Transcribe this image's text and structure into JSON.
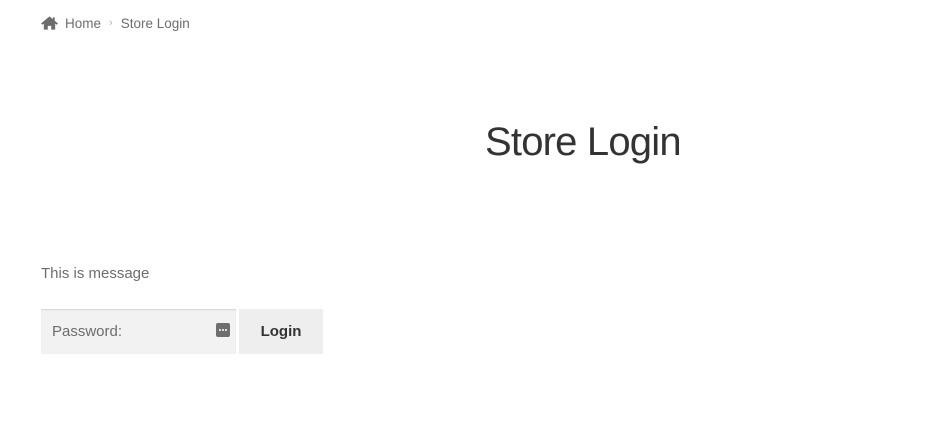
{
  "breadcrumb": {
    "home_label": "Home",
    "current_label": "Store Login"
  },
  "page": {
    "title": "Store Login",
    "message": "This is message"
  },
  "form": {
    "password_placeholder": "Password:",
    "password_value": "",
    "login_label": "Login"
  },
  "colors": {
    "text": "#6d6d6d",
    "heading": "#333333",
    "input_bg": "#f2f2f2",
    "button_bg": "#eeeeee"
  },
  "icons": {
    "home": "home-icon",
    "separator": "chevron-right-icon",
    "password_manager": "password-key-icon"
  }
}
